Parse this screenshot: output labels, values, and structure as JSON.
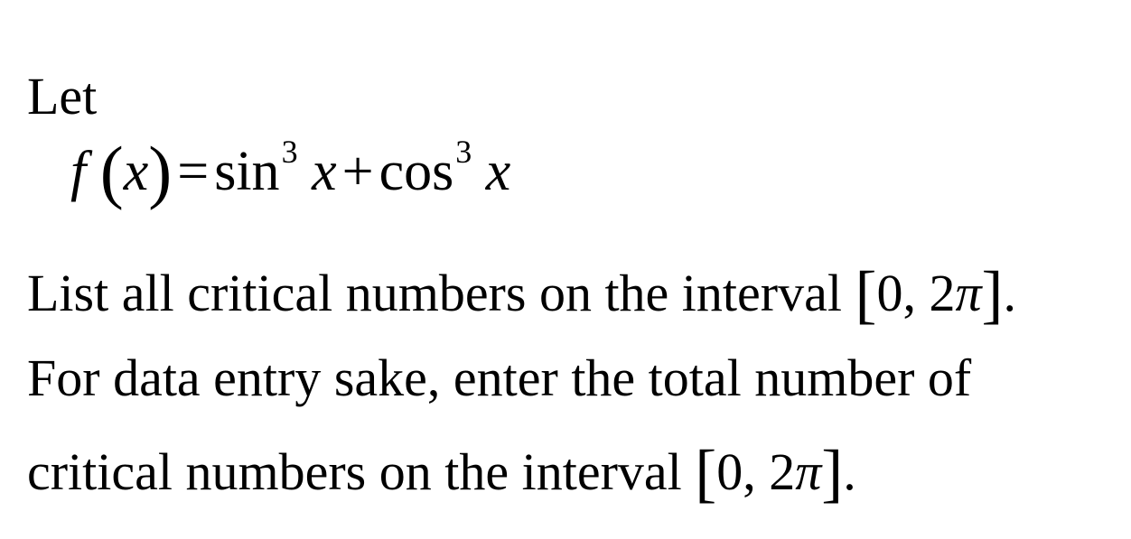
{
  "intro": "Let",
  "formula": {
    "func": "f",
    "lparen": "(",
    "var": "x",
    "rparen": ")",
    "equals": "=",
    "term1_fn": "sin",
    "term1_exp": "3",
    "term1_var": "x",
    "plus": "+",
    "term2_fn": "cos",
    "term2_exp": "3",
    "term2_var": "x"
  },
  "question_1": "List all critical numbers on the interval ",
  "question_2": "For data entry sake, enter the total number of",
  "question_3": "critical numbers on the interval ",
  "interval": {
    "open": "[",
    "content": "0, 2",
    "pi": "π",
    "close": "]",
    "end": "."
  }
}
